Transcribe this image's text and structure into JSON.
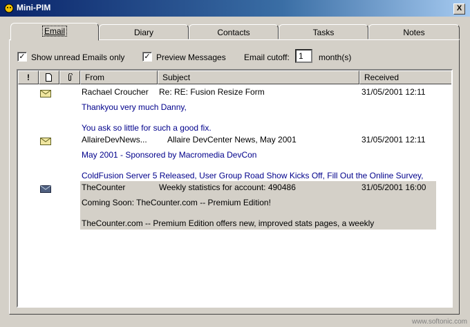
{
  "window": {
    "title": "Mini-PIM",
    "close_label": "X"
  },
  "tabs": [
    {
      "label": "Email",
      "active": true
    },
    {
      "label": "Diary"
    },
    {
      "label": "Contacts"
    },
    {
      "label": "Tasks"
    },
    {
      "label": "Notes"
    }
  ],
  "options": {
    "show_unread_label": "Show unread Emails only",
    "show_unread_checked": "✓",
    "preview_label": "Preview Messages",
    "preview_checked": "✓",
    "cutoff_label": "Email cutoff:",
    "cutoff_value": "1",
    "cutoff_unit": "month(s)"
  },
  "columns": {
    "priority": "!",
    "type": "",
    "attach": "",
    "from": "From",
    "subject": "Subject",
    "received": "Received"
  },
  "emails": [
    {
      "from": "Rachael Croucher",
      "subject": "Re: RE: Fusion Resize Form",
      "received": "31/05/2001 12:11",
      "preview1": "Thankyou very much Danny,",
      "preview2": "You ask so little for such a good fix."
    },
    {
      "from": "AllaireDevNews...",
      "subject": "Allaire DevCenter News, May 2001",
      "received": "31/05/2001 12:11",
      "preview1": "May 2001 - Sponsored by Macromedia DevCon",
      "preview2": "ColdFusion Server 5 Released, User Group Road Show Kicks Off, Fill Out the Online Survey,"
    },
    {
      "from": "TheCounter",
      "subject": "Weekly statistics for account: 490486",
      "received": "31/05/2001 16:00",
      "preview1": "Coming Soon: TheCounter.com -- Premium Edition!",
      "preview2": "TheCounter.com -- Premium Edition offers new, improved stats pages, a weekly"
    }
  ],
  "watermark": "www.softonic.com",
  "colors": {
    "title_bar": "#0a246a",
    "preview_text": "#00008b",
    "selection": "#d4d0c8"
  }
}
